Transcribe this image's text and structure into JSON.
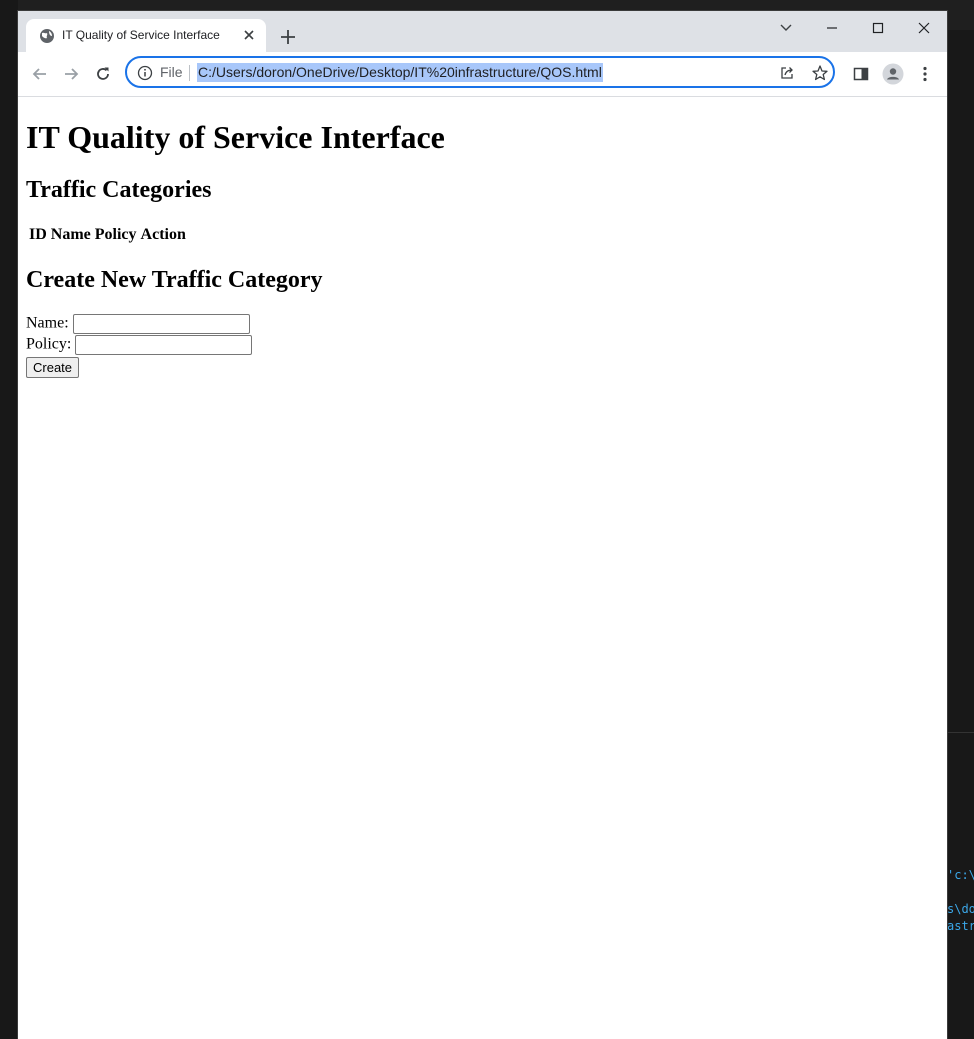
{
  "browser": {
    "tab_title": "IT Quality of Service Interface",
    "scheme_label": "File",
    "url": "C:/Users/doron/OneDrive/Desktop/IT%20infrastructure/QOS.html",
    "accent_color": "#1a73e8",
    "selection_color": "#a8c7fa"
  },
  "page": {
    "title": "IT Quality of Service Interface",
    "categories_heading": "Traffic Categories",
    "table_headers": [
      "ID",
      "Name",
      "Policy",
      "Action"
    ],
    "create_heading": "Create New Traffic Category",
    "name_label": "Name:",
    "name_value": "",
    "policy_label": "Policy:",
    "policy_value": "",
    "create_button": "Create"
  },
  "background_terminal": {
    "lines": [
      "'c:\\U",
      "s\\dor",
      "astru"
    ]
  },
  "icons": {
    "favicon": "globe-icon",
    "tab_close": "close-icon",
    "new_tab": "plus-icon",
    "back": "arrow-left-icon",
    "forward": "arrow-right-icon",
    "reload": "reload-icon",
    "info": "info-icon",
    "share": "share-icon",
    "bookmark": "star-icon",
    "side_panel": "side-panel-icon",
    "profile": "profile-icon",
    "menu": "kebab-menu-icon"
  }
}
